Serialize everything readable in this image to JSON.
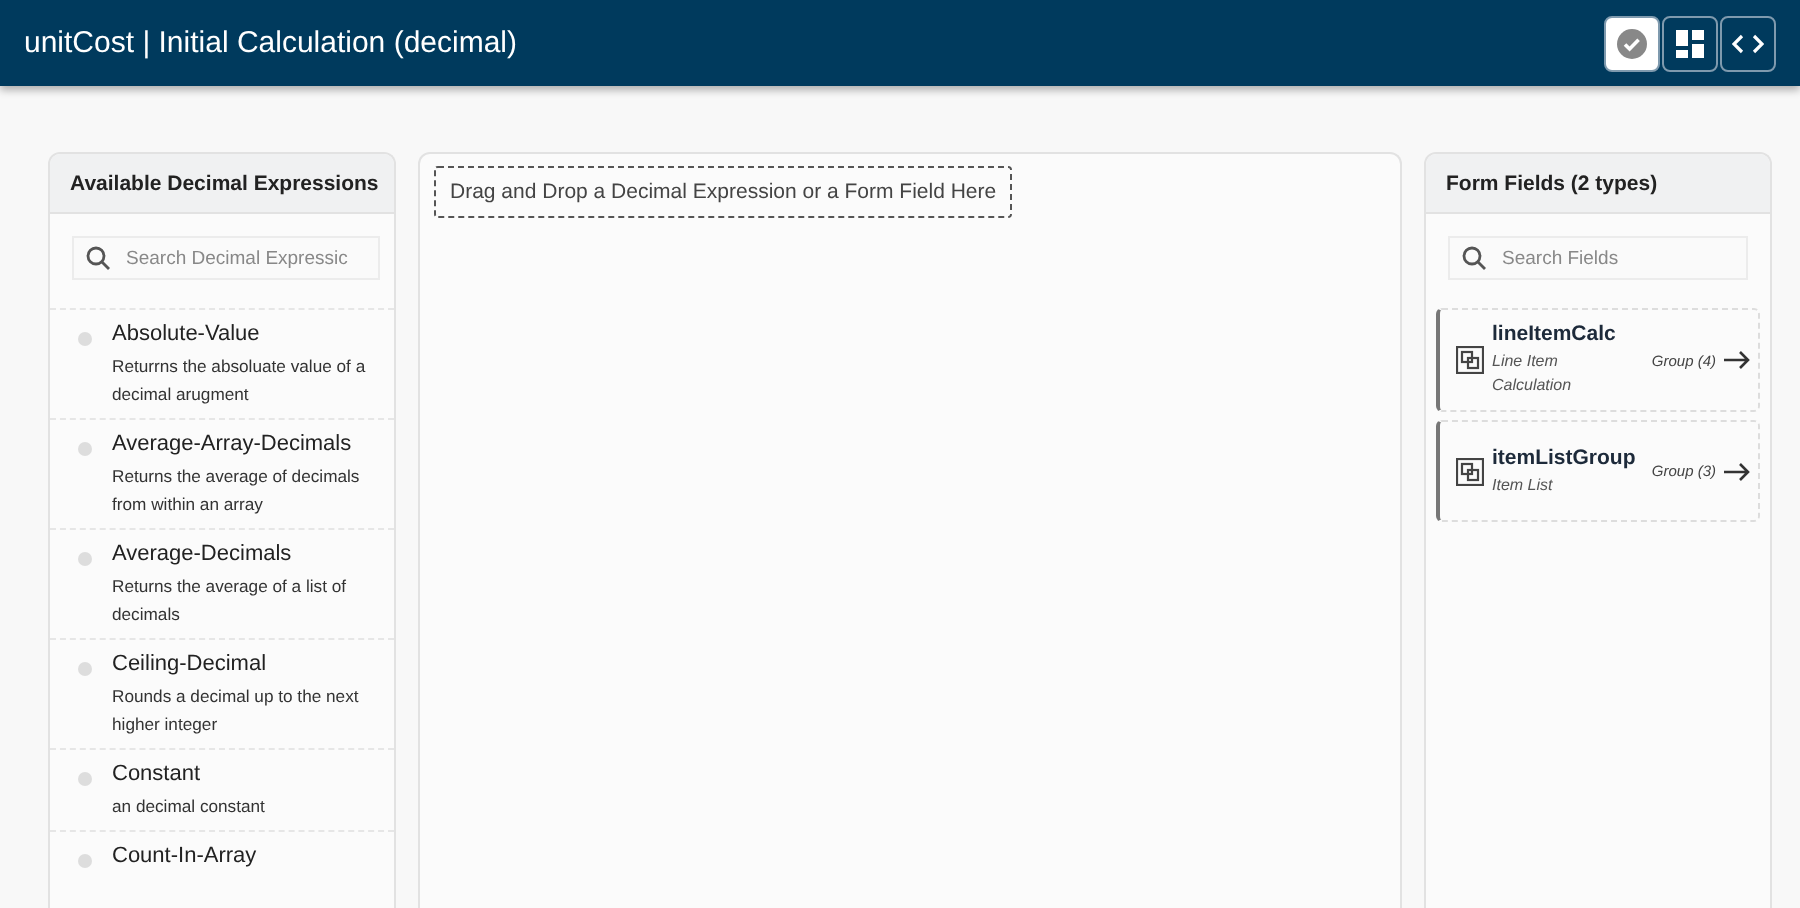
{
  "header": {
    "title": "unitCost | Initial Calculation (decimal)",
    "toolbar": [
      {
        "kind": "check",
        "selected": true
      },
      {
        "kind": "grid",
        "selected": false
      },
      {
        "kind": "code",
        "selected": false
      }
    ]
  },
  "expressions_panel": {
    "title": "Available Decimal Expressions",
    "search": {
      "placeholder": "Search Decimal Expressic"
    },
    "items": [
      {
        "name": "Absolute-Value",
        "description": "Returrns the absoluate value of a decimal arugment"
      },
      {
        "name": "Average-Array-Decimals",
        "description": "Returns the average of decimals from within an array"
      },
      {
        "name": "Average-Decimals",
        "description": "Returns the average of a list of decimals"
      },
      {
        "name": "Ceiling-Decimal",
        "description": "Rounds a decimal up to the next higher integer"
      },
      {
        "name": "Constant",
        "description": "an decimal constant"
      },
      {
        "name": "Count-In-Array"
      }
    ]
  },
  "canvas": {
    "drop_hint": "Drag and Drop a Decimal Expression or a Form Field Here"
  },
  "fields_panel": {
    "title": "Form Fields (2 types)",
    "search": {
      "placeholder": "Search Fields"
    },
    "items": [
      {
        "name": "lineItemCalc",
        "label": "Line Item Calculation",
        "type": "Group (4)"
      },
      {
        "name": "itemListGroup",
        "label": "Item List",
        "type": "Group (3)"
      }
    ]
  }
}
